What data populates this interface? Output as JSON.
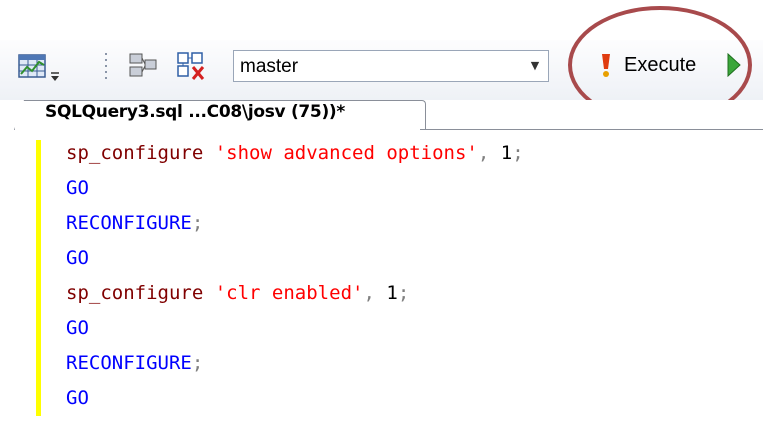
{
  "toolbar": {
    "database": "master",
    "execute_label": "Execute",
    "icons": [
      "results-grid-icon",
      "dropdown-arrow-icon",
      "display-plan-icon",
      "query-options-icon"
    ],
    "highlight_color": "#a84a4c"
  },
  "tab": {
    "title": "SQLQuery3.sql ...C08\\josv (75))*"
  },
  "editor": {
    "lines": [
      {
        "fn": "sp_configure",
        "str": "'show advanced options'",
        "sep": ",",
        "num": "1",
        "end": ";"
      },
      {
        "kw": "GO"
      },
      {
        "kw": "RECONFIGURE",
        "end": ";"
      },
      {
        "kw": "GO"
      },
      {
        "fn": "sp_configure",
        "str": "'clr enabled'",
        "sep": ",",
        "num": "1",
        "end": ";"
      },
      {
        "kw": "GO"
      },
      {
        "kw": "RECONFIGURE",
        "end": ";"
      },
      {
        "kw": "GO"
      }
    ]
  },
  "colors": {
    "keyword": "#0000ff",
    "string": "#ff0000",
    "function": "#800000",
    "punctuation": "#808080",
    "gutter": "#ffff00"
  }
}
